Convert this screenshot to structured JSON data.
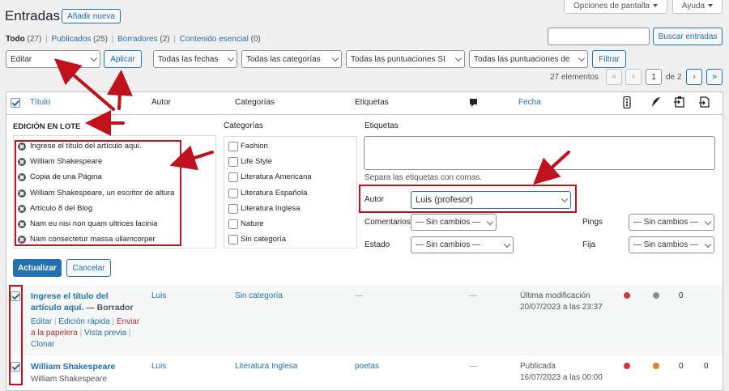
{
  "header": {
    "title": "Entradas",
    "add_new": "Añadir nueva",
    "screen_options": "Opciones de pantalla",
    "help": "Ayuda"
  },
  "subsubsub": {
    "all_label": "Todo",
    "all_count": "(27)",
    "published_label": "Publicados",
    "published_count": "(25)",
    "drafts_label": "Borradores",
    "drafts_count": "(2)",
    "sticky_label": "Contenido esencial",
    "sticky_count": "(0)",
    "sep": "|"
  },
  "search": {
    "value": "",
    "button": "Buscar entradas"
  },
  "filters": {
    "bulk_action": "Editar",
    "apply": "Aplicar",
    "dates": "Todas las fechas",
    "categories": "Todas las categorías",
    "ratings_sl": "Todas las puntuaciones SI",
    "ratings_de": "Todas las puntuaciones de",
    "filter_button": "Filtrar"
  },
  "pagination": {
    "items": "27 elementos",
    "first": "«",
    "prev": "‹",
    "current": "1",
    "of": "de 2",
    "next": "›",
    "last": "»"
  },
  "columns": {
    "title": "Título",
    "author": "Autor",
    "categories": "Categorías",
    "tags": "Etiquetas",
    "date": "Fecha",
    "comments_icon": "speech-bubble-icon",
    "rating_icon": "traffic-light-icon",
    "feather_icon": "feather-icon",
    "clipboard_icon": "clipboard-in-icon",
    "export_icon": "export-icon"
  },
  "bulk_edit": {
    "heading": "EDICIÓN EN LOTE",
    "posts": [
      "Ingrese el título del artículo aquí.",
      "William Shakespeare",
      "Copia de una Página",
      "William Shakespeare, un escritor de altura",
      "Artículo 8 del Blog",
      "Nam eu nisi non quam ultrices lacinia",
      "Nam consectetur massa ullamcorper"
    ],
    "categories_label": "Categorías",
    "categories": [
      "Fashion",
      "Life Style",
      "Literatura Americana",
      "Literatura Española",
      "Literatura Inglesa",
      "Nature",
      "Sin categoría"
    ],
    "tags_label": "Etiquetas",
    "tags_hint": "Separa las etiquetas con comas.",
    "author_label": "Autor",
    "author_value": "Luis (profesor)",
    "comments_label": "Comentarios",
    "comments_value": "— Sin cambios —",
    "status_label": "Estado",
    "status_value": "— Sin cambios —",
    "pings_label": "Pings",
    "pings_value": "— Sin cambios —",
    "sticky_label": "Fija",
    "sticky_value": "— Sin cambios —",
    "update": "Actualizar",
    "cancel": "Cancelar"
  },
  "rows": [
    {
      "title_line1": "Ingrese el título del",
      "title_line2": "artículo aquí.",
      "state": " — Borrador",
      "author": "Luis",
      "category": "Sin categoría",
      "tags": "—",
      "comments": "—",
      "date_status": "Última modificación",
      "date": "20/07/2023 a las 23:37",
      "count1": "0",
      "actions": {
        "edit": "Editar",
        "quick": "Edición rápida",
        "trash1": "Enviar",
        "trash2": "a la papelera",
        "view": "Vista previa",
        "clone": "Clonar"
      },
      "dot1": "#d63638",
      "dot2": "#8c8f94"
    },
    {
      "title_line1": "William Shakespeare",
      "excerpt": "William Shakespeare",
      "author": "Luis",
      "category": "Literatura Inglesa",
      "tags": "poetas",
      "comments": "—",
      "date_status": "Publicada",
      "date": "16/07/2023 a las 00:00",
      "count1": "0",
      "count2": "0",
      "dot1": "#d63638",
      "dot2": "#e67e22"
    }
  ]
}
